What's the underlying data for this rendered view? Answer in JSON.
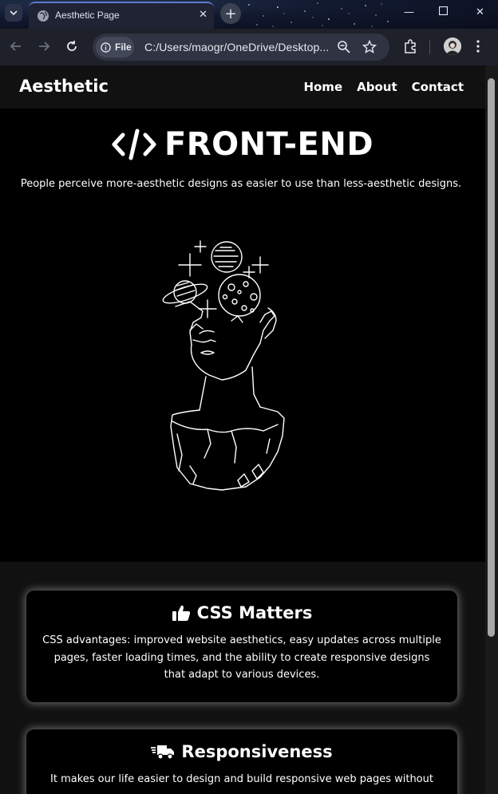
{
  "browser": {
    "tab_title": "Aesthetic Page",
    "chip_label": "File",
    "url": "C:/Users/maogr/OneDrive/Desktop..."
  },
  "page": {
    "brand": "Aesthetic",
    "nav": [
      {
        "label": "Home"
      },
      {
        "label": "About"
      },
      {
        "label": "Contact"
      }
    ],
    "hero": {
      "title": "FRONT-END",
      "subtitle": "People perceive more-aesthetic designs as easier to use than less-aesthetic designs."
    },
    "cards": [
      {
        "title": "CSS Matters",
        "icon": "thumbs-up-icon",
        "text": "CSS advantages: improved website aesthetics, easy updates across multiple pages, faster loading times, and the ability to create responsive designs that adapt to various devices."
      },
      {
        "title": "Responsiveness",
        "icon": "truck-fast-icon",
        "text": "It makes our life easier to design and build responsive web pages without"
      }
    ]
  },
  "colors": {
    "page_bg": "#000000",
    "navbar_bg": "#111111",
    "section_bg": "#111111",
    "text": "#ffffff",
    "tab_accent": "#5b7bd1"
  }
}
